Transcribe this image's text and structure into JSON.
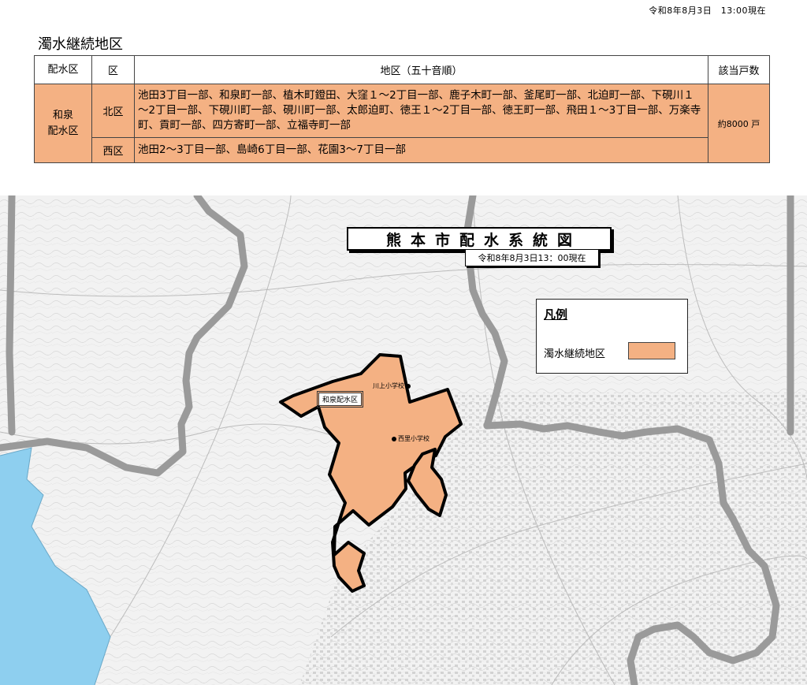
{
  "report_date": "令和8年8月3日　13:00現在",
  "section_title": "濁水継続地区",
  "table": {
    "headers": {
      "area": "配水区",
      "ward": "区",
      "districts": "地区（五十音順）",
      "households": "該当戸数"
    },
    "area_name_line1": "和泉",
    "area_name_line2": "配水区",
    "rows": [
      {
        "ward": "北区",
        "districts": "池田3丁目一部、和泉町一部、植木町鐙田、大窪１～2丁目一部、鹿子木町一部、釜尾町一部、北迫町一部、下硯川１～2丁目一部、下硯川町一部、硯川町一部、太郎迫町、徳王１～2丁目一部、徳王町一部、飛田１～3丁目一部、万楽寺町、貢町一部、四方寄町一部、立福寺町一部"
      },
      {
        "ward": "西区",
        "districts": "池田2～3丁目一部、島崎6丁目一部、花園3～7丁目一部"
      }
    ],
    "household_count": "約8000 戸"
  },
  "map": {
    "title": "熊本市配水系統図",
    "date": "令和8年8月3日13：00現在",
    "legend_title": "凡例",
    "legend_label": "濁水継続地区",
    "district_label": "和泉配水区",
    "schools": [
      "川上小学校",
      "西里小学校"
    ],
    "colors": {
      "affected_area": "#f4b183",
      "boundary": "#9a9a9a",
      "sea": "#8ecfef"
    }
  }
}
